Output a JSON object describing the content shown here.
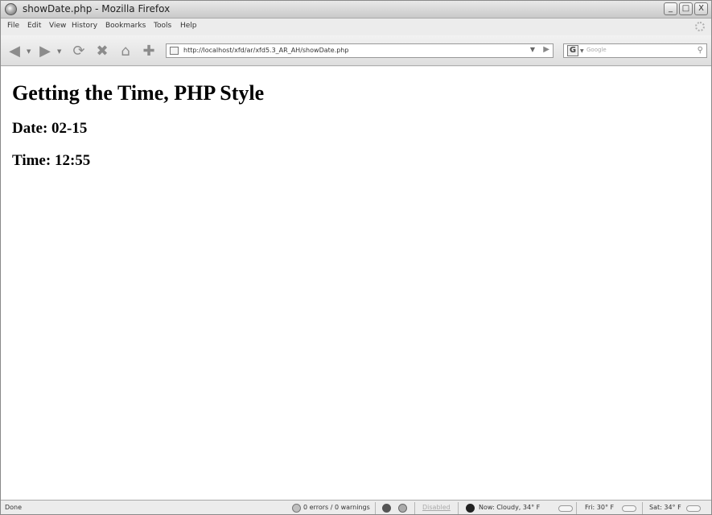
{
  "window": {
    "title": "showDate.php - Mozilla Firefox",
    "controls": [
      "_",
      "□",
      "X"
    ]
  },
  "menu": {
    "items": [
      "File",
      "Edit",
      "View",
      "History",
      "Bookmarks",
      "Tools",
      "Help"
    ]
  },
  "nav": {
    "url": "http://localhost/xfd/ar/xfd5.3_AR_AH/showDate.php",
    "search_placeholder": "Google",
    "search_engine_letter": "G"
  },
  "page": {
    "heading": "Getting the Time, PHP Style",
    "date_line": "Date: 02-15",
    "time_line": "Time: 12:55"
  },
  "status": {
    "left": "Done",
    "errors": "0 errors / 0 warnings",
    "disabled": "Disabled",
    "weather_now": "Now: Cloudy, 34° F",
    "weather_fri": "Fri: 30° F",
    "weather_sat": "Sat: 34° F"
  },
  "colors": {
    "chrome": "#ececec",
    "page_bg": "#ffffff",
    "text": "#000000"
  }
}
